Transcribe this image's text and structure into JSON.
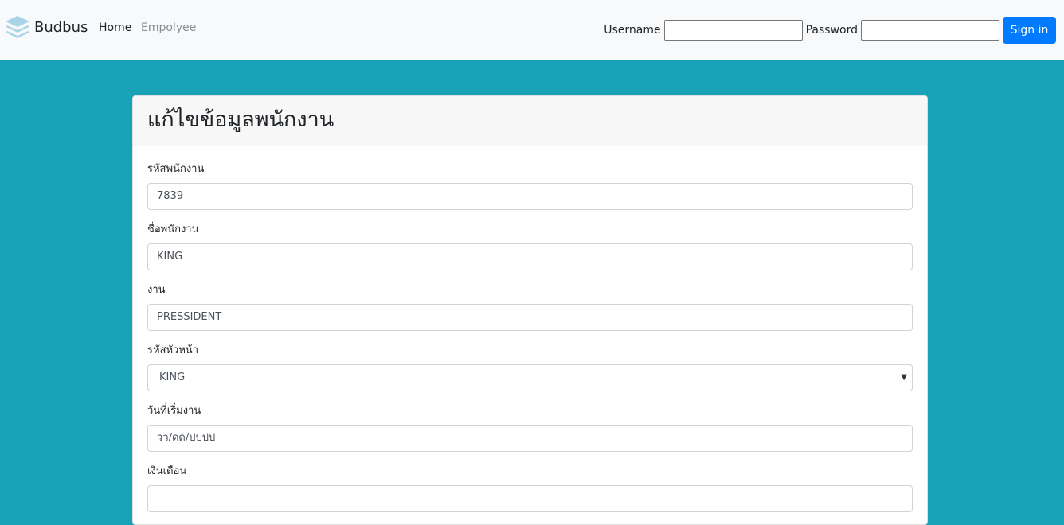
{
  "navbar": {
    "brand": "Budbus",
    "links": [
      "Home",
      "Empolyee"
    ],
    "username_label": "Username",
    "password_label": "Password",
    "username_value": "",
    "password_value": "",
    "signin_label": "Sign in"
  },
  "form": {
    "title": "แก้ไขข้อมูลพนักงาน",
    "fields": [
      {
        "label": "รหัสพนักงาน",
        "value": "7839"
      },
      {
        "label": "ชื่อพนักงาน",
        "value": "KING"
      },
      {
        "label": "งาน",
        "value": "PRESSIDENT"
      },
      {
        "label": "รหัสหัวหน้า",
        "value": "KING"
      },
      {
        "label": "วันที่เริ่มงาน",
        "value": "วว/ดด/ปปปป"
      },
      {
        "label": "เงินเดือน",
        "value": ""
      }
    ]
  },
  "colors": {
    "background": "#17a2b8",
    "primary": "#007bff",
    "navbar": "#f8f9fa"
  }
}
